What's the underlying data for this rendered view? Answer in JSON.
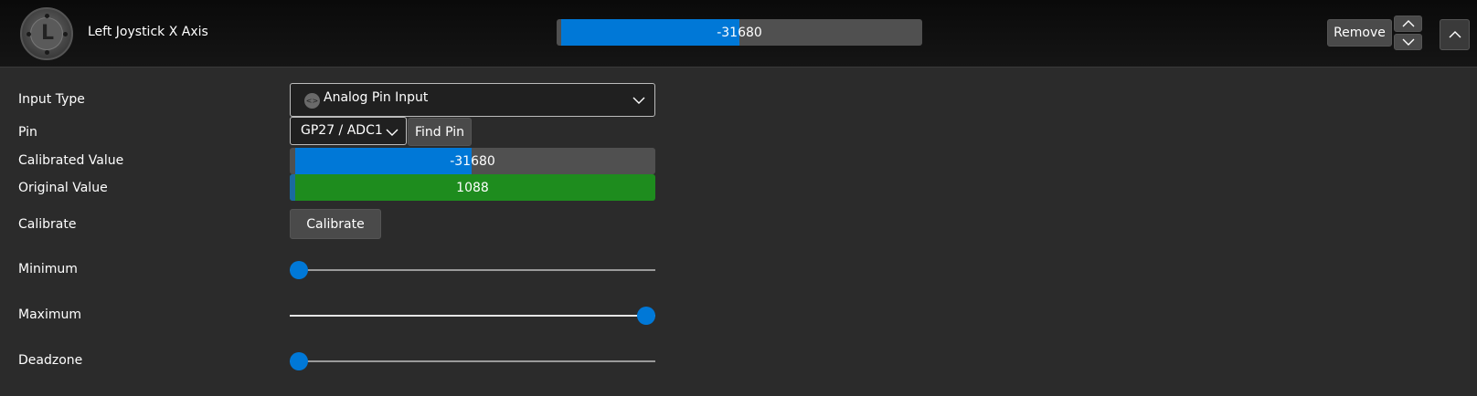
{
  "header": {
    "joystick_letter": "L",
    "title": "Left Joystick X Axis",
    "value_text": "-31680",
    "value_fraction": 0.0167,
    "remove_label": "Remove"
  },
  "form": {
    "input_type_label": "Input Type",
    "input_type_value": "Analog Pin Input",
    "pin_label": "Pin",
    "pin_value": "GP27 / ADC1",
    "find_pin_label": "Find Pin",
    "calibrated_label": "Calibrated Value",
    "calibrated_text": "-31680",
    "original_label": "Original Value",
    "original_text": "1088",
    "calibrate_label": "Calibrate",
    "calibrate_button": "Calibrate",
    "minimum_label": "Minimum",
    "maximum_label": "Maximum",
    "deadzone_label": "Deadzone",
    "minimum_fraction": 0.0,
    "maximum_fraction": 1.0,
    "deadzone_fraction": 0.0
  },
  "colors": {
    "accent": "#0078d7",
    "original_bar": "#1e8c1e",
    "bar_bg": "#505050",
    "background": "#2b2b2b"
  },
  "icons": [
    "joystick-l-icon",
    "analog-pin-icon",
    "chevron-down-icon",
    "chevron-up-icon"
  ]
}
